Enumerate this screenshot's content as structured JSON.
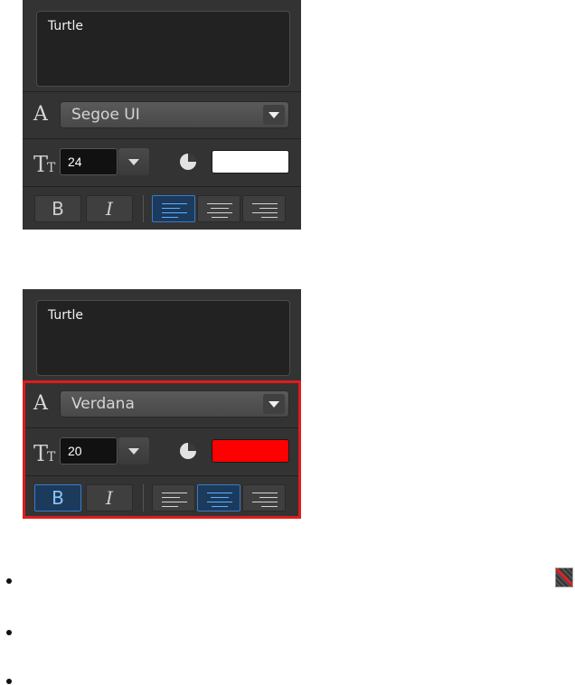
{
  "panels": [
    {
      "text_value": "Turtle",
      "font_letter": "A",
      "font_name": "Segoe UI",
      "size_icon": "text-size-icon",
      "size_value": "24",
      "color_swatch": "#ffffff",
      "bold_label": "B",
      "italic_label": "I",
      "bold_active": false,
      "alignment": "left"
    },
    {
      "text_value": "Turtle",
      "font_letter": "A",
      "font_name": "Verdana",
      "size_icon": "text-size-icon",
      "size_value": "20",
      "color_swatch": "#ff0000",
      "bold_label": "B",
      "italic_label": "I",
      "bold_active": true,
      "alignment": "center"
    }
  ],
  "colors": {
    "panel_bg": "#333333",
    "highlight_border": "#e01b1b",
    "active_accent": "#3a7bc8"
  },
  "icons": {
    "dropdown": "chevron-down-icon",
    "color": "color-picker-icon",
    "align_left": "align-left-icon",
    "align_center": "align-center-icon",
    "align_right": "align-right-icon",
    "transparent_color": "no-color-icon"
  }
}
